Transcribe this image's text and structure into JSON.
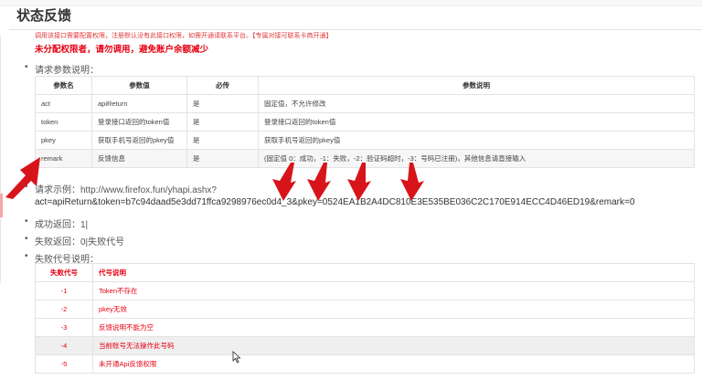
{
  "page": {
    "title": "状态反馈",
    "notice": "调用该接口需要配置权限，注册默认没有此接口权限，如需开通请联系平台。【专属对接可联系卡商开通】",
    "warning": "未分配权限者，请勿调用，避免账户余额减少"
  },
  "request_params": {
    "heading": "请求参数说明：",
    "columns": [
      "参数名",
      "参数值",
      "必传",
      "参数说明"
    ],
    "rows": [
      [
        "act",
        "apiReturn",
        "是",
        "固定值，不允许修改"
      ],
      [
        "token",
        "登录接口返回的token值",
        "是",
        "登录接口返回的token值"
      ],
      [
        "pkey",
        "获取手机号返回的pkey值",
        "是",
        "获取手机号返回的pkey值"
      ],
      [
        "remark",
        "反馈信息",
        "是",
        "(固定值 0：成功，-1：失败，-2：验证码超时，-3：号码已注册)，其他信息请直接输入"
      ]
    ]
  },
  "example": {
    "label": "请求示例：http://www.firefox.fun/yhapi.ashx?",
    "query": "act=apiReturn&token=b7c94daad5e3dd71ffca9298976ec0d4_3&pkey=0524EA1B2A4DC810E3E535BE036C2C170E914ECC4D46ED19&remark=0"
  },
  "success": "成功返回：1|",
  "failure": "失败返回：0|失败代号",
  "failure_codes": {
    "heading": "失败代号说明：",
    "columns": [
      "失败代号",
      "代号说明"
    ],
    "rows": [
      [
        "-1",
        "Token不存在"
      ],
      [
        "-2",
        "pkey无效"
      ],
      [
        "-3",
        "反馈说明不能为空"
      ],
      [
        "-4",
        "当前账号无法操作此号码"
      ],
      [
        "-5",
        "未开通Api反馈权限"
      ]
    ]
  },
  "colors": {
    "accent_red": "#e60012",
    "arrow_red": "#d7141a"
  },
  "icons": [
    "red-arrow-icon",
    "mouse-cursor-icon"
  ]
}
